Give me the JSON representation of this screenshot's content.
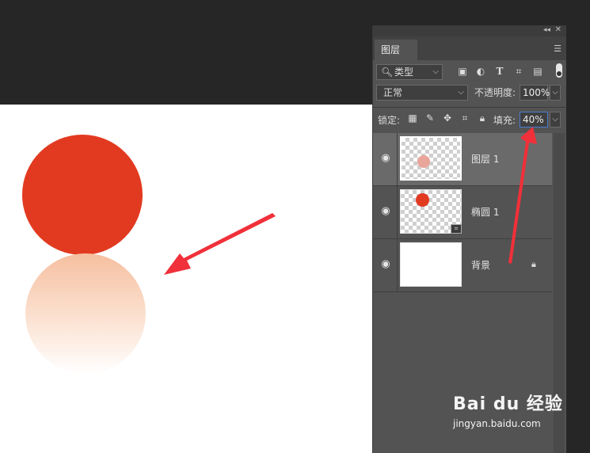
{
  "panel": {
    "tab_label": "图层",
    "filter_kind": "类型",
    "blend_mode": "正常",
    "opacity_label": "不透明度:",
    "opacity_value": "100%",
    "lock_label": "锁定:",
    "fill_label": "填充:",
    "fill_value": "40%"
  },
  "layers": [
    {
      "name": "图层 1",
      "selected": true
    },
    {
      "name": "椭圆 1",
      "selected": false
    },
    {
      "name": "背景",
      "selected": false
    }
  ],
  "watermark": {
    "logo": "Bai du 经验",
    "url": "jingyan.baidu.com"
  },
  "colors": {
    "shape_red": "#e23a20",
    "annotation_arrow": "#f0303a",
    "panel_bg": "#535353"
  }
}
